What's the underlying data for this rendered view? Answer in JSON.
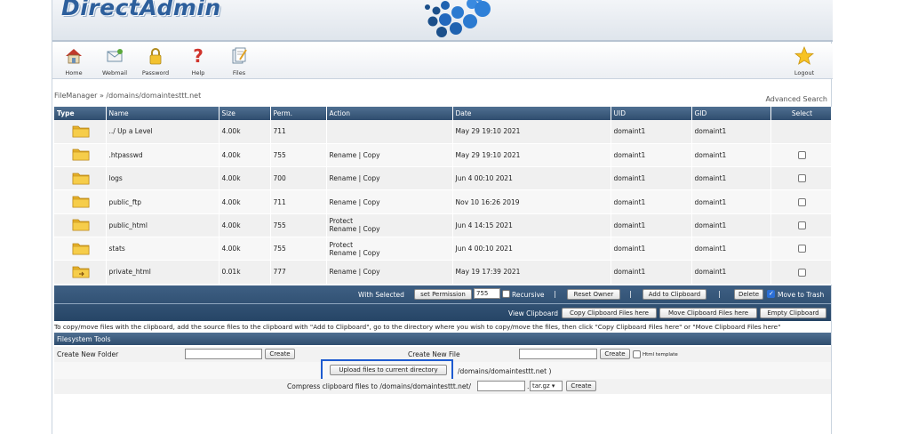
{
  "header": {
    "logo_text": "DirectAdmin",
    "toolbar": [
      {
        "label": "Home",
        "icon": "home-icon"
      },
      {
        "label": "Webmail",
        "icon": "webmail-icon"
      },
      {
        "label": "Password",
        "icon": "lock-icon"
      },
      {
        "label": "Help",
        "icon": "help-icon"
      },
      {
        "label": "Files",
        "icon": "files-icon"
      }
    ],
    "logout_label": "Logout"
  },
  "breadcrumb": "FileManager » /domains/domaintesttt.net",
  "advanced_search": "Advanced Search",
  "table": {
    "headers": {
      "type": "Type",
      "name": "Name",
      "size": "Size",
      "perm": "Perm.",
      "action": "Action",
      "date": "Date",
      "uid": "UID",
      "gid": "GID",
      "select": "Select"
    },
    "rows": [
      {
        "name": "../ Up a Level",
        "size": "4.00k",
        "perm": "711",
        "action1": "",
        "action2": "",
        "date": "May 29 19:10 2021",
        "uid": "domaint1",
        "gid": "domaint1",
        "selectable": false,
        "icon": "folder-icon"
      },
      {
        "name": ".htpasswd",
        "size": "4.00k",
        "perm": "755",
        "action1": "Rename | Copy",
        "action2": "",
        "date": "May 29 19:10 2021",
        "uid": "domaint1",
        "gid": "domaint1",
        "selectable": true,
        "icon": "folder-icon"
      },
      {
        "name": "logs",
        "size": "4.00k",
        "perm": "700",
        "action1": "Rename | Copy",
        "action2": "",
        "date": "Jun 4 00:10 2021",
        "uid": "domaint1",
        "gid": "domaint1",
        "selectable": true,
        "icon": "folder-icon"
      },
      {
        "name": "public_ftp",
        "size": "4.00k",
        "perm": "711",
        "action1": "Rename | Copy",
        "action2": "",
        "date": "Nov 10 16:26 2019",
        "uid": "domaint1",
        "gid": "domaint1",
        "selectable": true,
        "icon": "folder-icon"
      },
      {
        "name": "public_html",
        "size": "4.00k",
        "perm": "755",
        "action1": "Protect",
        "action2": "Rename | Copy",
        "date": "Jun 4 14:15 2021",
        "uid": "domaint1",
        "gid": "domaint1",
        "selectable": true,
        "icon": "folder-icon"
      },
      {
        "name": "stats",
        "size": "4.00k",
        "perm": "755",
        "action1": "Protect",
        "action2": "Rename | Copy",
        "date": "Jun 4 00:10 2021",
        "uid": "domaint1",
        "gid": "domaint1",
        "selectable": true,
        "icon": "folder-icon"
      },
      {
        "name": "private_html",
        "size": "0.01k",
        "perm": "777",
        "action1": "Rename | Copy",
        "action2": "",
        "date": "May 19 17:39 2021",
        "uid": "domaint1",
        "gid": "domaint1",
        "selectable": true,
        "icon": "folder-link-icon"
      }
    ]
  },
  "actions": {
    "with_selected": "With Selected",
    "set_permission": "set Permission",
    "permission_value": "755",
    "recursive": "Recursive",
    "reset_owner": "Reset Owner",
    "add_to_clipboard": "Add to Clipboard",
    "delete": "Delete",
    "move_to_trash": "Move to Trash",
    "view_clipboard": "View Clipboard",
    "copy_clipboard": "Copy Clipboard Files here",
    "move_clipboard": "Move Clipboard Files here",
    "empty_clipboard": "Empty Clipboard",
    "separator": "|"
  },
  "note": "To copy/move files with the clipboard, add the source files to the clipboard with \"Add to Clipboard\", go to the directory where you wish to copy/move the files, then click \"Copy Clipboard Files here\" or \"Move Clipboard Files here\"",
  "tools": {
    "title": "Filesystem Tools",
    "new_folder_label": "Create New Folder",
    "new_file_label": "Create New File",
    "create": "Create",
    "html_template": "Html template",
    "upload_button": "Upload files to current directory",
    "upload_path": "/domains/domaintesttt.net )",
    "compress_label": "Compress clipboard files to /domains/domaintesttt.net/",
    "compress_format": "tar.gz",
    "dot": "."
  },
  "colors": {
    "header_blue": "#2f4d6e",
    "highlight": "#1e5bd0"
  }
}
